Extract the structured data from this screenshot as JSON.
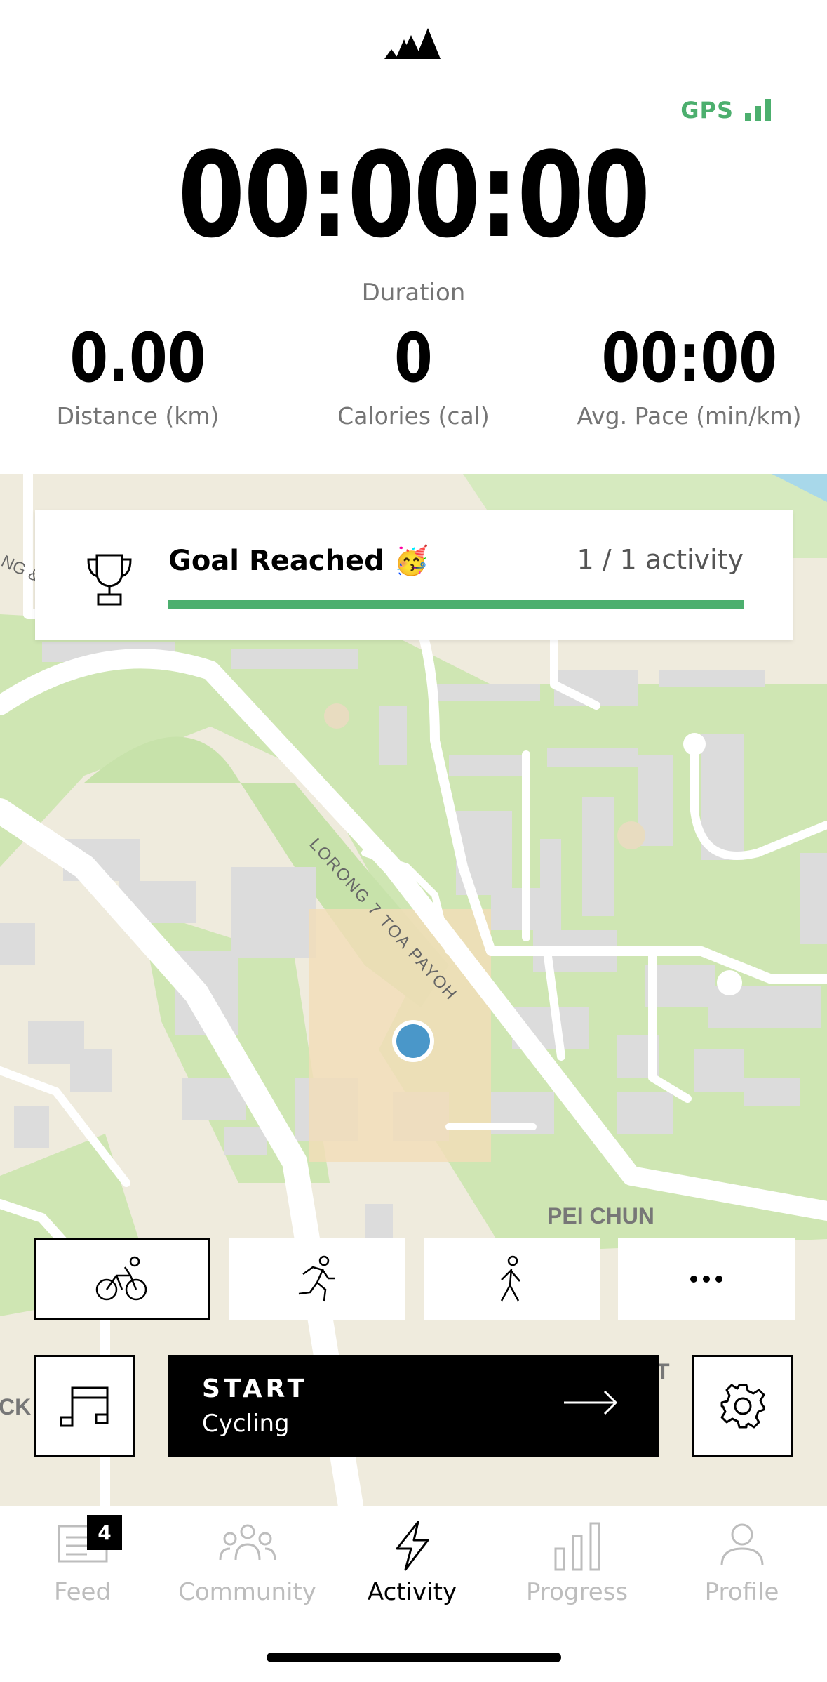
{
  "header": {
    "logo": "adidas-logo",
    "gps_label": "GPS",
    "gps_color": "#4CAF6E"
  },
  "timer": {
    "value": "00:00:00",
    "label": "Duration"
  },
  "stats": [
    {
      "value": "0.00",
      "label": "Distance (km)"
    },
    {
      "value": "0",
      "label": "Calories (cal)"
    },
    {
      "value": "00:00",
      "label": "Avg. Pace (min/km)"
    }
  ],
  "map": {
    "street_label": "LORONG 7 TOA PAYOH",
    "area_label": "PEI CHUN",
    "edge_label_left": "CK",
    "edge_label_top": "NG &",
    "edge_label_right": "T"
  },
  "goal": {
    "title": "Goal Reached 🥳",
    "progress_text": "1 / 1 activity",
    "progress": 1.0
  },
  "sport_types": [
    {
      "icon": "cycling-icon",
      "selected": true
    },
    {
      "icon": "running-icon",
      "selected": false
    },
    {
      "icon": "walking-icon",
      "selected": false
    },
    {
      "icon": "more-icon",
      "selected": false
    }
  ],
  "controls": {
    "start_label": "START",
    "activity_label": "Cycling"
  },
  "tabs": [
    {
      "label": "Feed",
      "icon": "feed-icon",
      "badge": "4"
    },
    {
      "label": "Community",
      "icon": "community-icon"
    },
    {
      "label": "Activity",
      "icon": "activity-icon",
      "active": true
    },
    {
      "label": "Progress",
      "icon": "progress-icon"
    },
    {
      "label": "Profile",
      "icon": "profile-icon"
    }
  ]
}
